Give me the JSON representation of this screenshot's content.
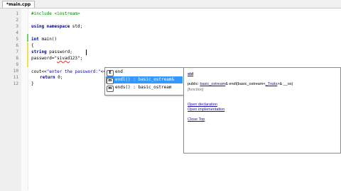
{
  "tab": {
    "label": "*main.cpp"
  },
  "line_numbers": [
    "1",
    "2",
    "3",
    "4",
    "5",
    "6",
    "7",
    "8",
    "9",
    "10",
    "11",
    "12"
  ],
  "code": {
    "l1": "#include <iostream>",
    "l3_kw": "using namespace",
    "l3_rest": " std;",
    "l5_kw": "int",
    "l5_rest": " main()",
    "l6": "{",
    "l7_kw": "string",
    "l7_rest": " password;",
    "l8_a": "password=\"",
    "l8_b": "sivad",
    "l8_c": "123\";",
    "l10_a": "cout<<",
    "l10_str": "\"enter the password:\"",
    "l10_b": "<<endl",
    "l11_kw": "return",
    "l11_rest": " 0;",
    "l12": "}"
  },
  "autocomplete": {
    "items": [
      {
        "icon": "E",
        "label": "end"
      },
      {
        "icon": "m",
        "label": "endl() : basic_ostream&",
        "selected": true
      },
      {
        "icon": "m",
        "label": "ends() : basic_ostream"
      }
    ]
  },
  "doc_panel": {
    "title": "std",
    "sig_pre": "public: ",
    "sig_link1": "basic_ostream",
    "sig_mid": "& endl(basic_ostream<",
    "sig_link2": "_Traits",
    "sig_post": ">& __os)",
    "category": "[function]",
    "link_decl": "Open declaration",
    "link_impl": "Open implementation",
    "link_close": "Close Top"
  }
}
